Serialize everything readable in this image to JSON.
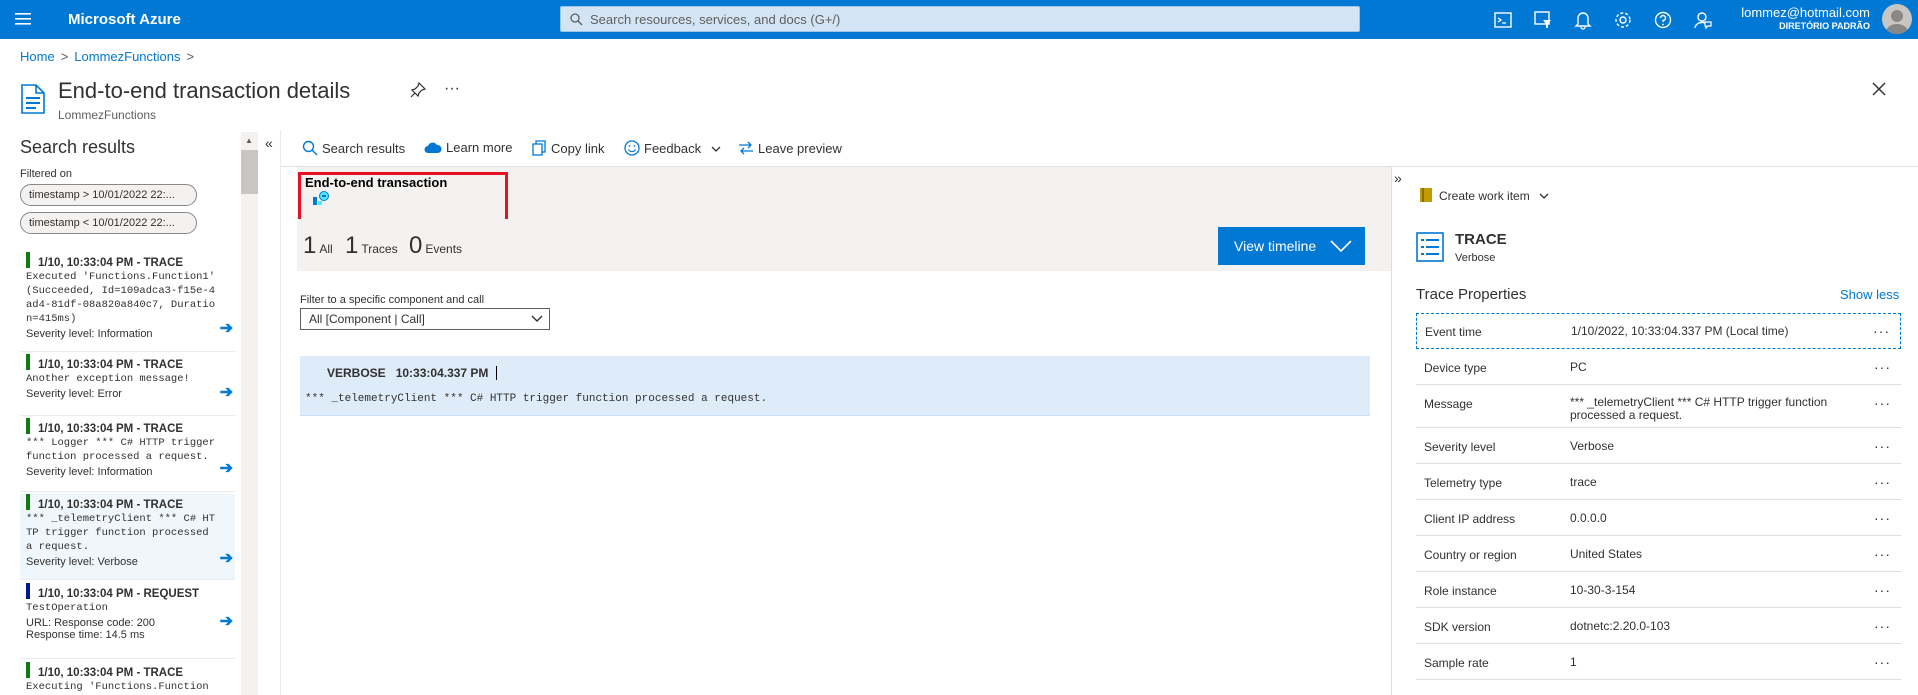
{
  "topbar": {
    "brand": "Microsoft Azure",
    "search_placeholder": "Search resources, services, and docs (G+/)",
    "user_email": "lommez@hotmail.com",
    "user_directory": "DIRETÓRIO PADRÃO",
    "icons": [
      "cloud-shell-icon",
      "directory-filter-icon",
      "notifications-icon",
      "settings-icon",
      "help-icon",
      "feedback-icon"
    ]
  },
  "breadcrumb": {
    "home": "Home",
    "resource": "LommezFunctions",
    "sep": ">"
  },
  "page": {
    "title": "End-to-end transaction details",
    "subtitle": "LommezFunctions",
    "more": "···"
  },
  "left": {
    "title": "Search results",
    "filtered_on": "Filtered on",
    "chips": [
      "timestamp > 10/01/2022 22:...",
      "timestamp < 10/01/2022 22:..."
    ],
    "items": [
      {
        "header": "1/10, 10:33:04 PM - TRACE",
        "body": "Executed 'Functions.Function1' (Succeeded, Id=109adca3-f15e-4ad4-81df-08a820a840c7, Duration=415ms)",
        "meta": "Severity level: Information"
      },
      {
        "header": "1/10, 10:33:04 PM - TRACE",
        "body": "Another exception message!",
        "meta": "Severity level: Error"
      },
      {
        "header": "1/10, 10:33:04 PM - TRACE",
        "body": "*** Logger *** C# HTTP trigger function processed a request.",
        "meta": "Severity level: Information"
      },
      {
        "header": "1/10, 10:33:04 PM - TRACE",
        "body": "*** _telemetryClient *** C# HTTP trigger function processed a request.",
        "meta": "Severity level: Verbose"
      },
      {
        "header": "1/10, 10:33:04 PM - REQUEST",
        "body": "TestOperation",
        "meta": "URL:  Response code: 200",
        "meta2": "Response time: 14.5 ms"
      },
      {
        "header": "1/10, 10:33:04 PM - TRACE",
        "body": "Executing 'Functions.Function"
      }
    ]
  },
  "toolbar": {
    "search_results": "Search results",
    "learn_more": "Learn more",
    "copy_link": "Copy link",
    "feedback": "Feedback",
    "leave_preview": "Leave preview"
  },
  "main": {
    "e2e_title": "End-to-end transaction",
    "counts": [
      {
        "n": "1",
        "label": "All"
      },
      {
        "n": "1",
        "label": "Traces"
      },
      {
        "n": "0",
        "label": "Events"
      }
    ],
    "view_timeline": "View timeline",
    "filter_label": "Filter to a specific component and call",
    "filter_value": "All [Component | Call]",
    "trace_level": "VERBOSE",
    "trace_time": "10:33:04.337 PM",
    "trace_message": "*** _telemetryClient *** C# HTTP trigger function processed a request."
  },
  "right": {
    "create_work_item": "Create work item",
    "trace_title": "TRACE",
    "trace_sub": "Verbose",
    "props_title": "Trace Properties",
    "show_less": "Show less",
    "props": [
      {
        "k": "Event time",
        "v": "1/10/2022, 10:33:04.337 PM (Local time)"
      },
      {
        "k": "Device type",
        "v": "PC"
      },
      {
        "k": "Message",
        "v": "*** _telemetryClient *** C# HTTP trigger function processed a request."
      },
      {
        "k": "Severity level",
        "v": "Verbose"
      },
      {
        "k": "Telemetry type",
        "v": "trace"
      },
      {
        "k": "Client IP address",
        "v": "0.0.0.0"
      },
      {
        "k": "Country or region",
        "v": "United States"
      },
      {
        "k": "Role instance",
        "v": "10-30-3-154"
      },
      {
        "k": "SDK version",
        "v": "dotnetc:2.20.0-103"
      },
      {
        "k": "Sample rate",
        "v": "1"
      }
    ],
    "row_more": "···"
  },
  "colors": {
    "accent": "#0078d4",
    "highlight": "#e81123",
    "trace": "#107c10",
    "request": "#00188f"
  }
}
